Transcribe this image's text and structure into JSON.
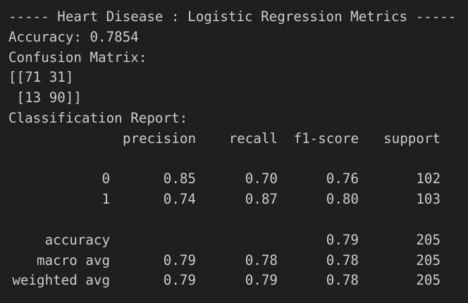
{
  "header": "----- Heart Disease : Logistic Regression Metrics -----",
  "accuracy_line": "Accuracy: 0.7854",
  "confusion_title": "Confusion Matrix:",
  "confusion_rows": [
    "[[71 31]",
    " [13 90]]"
  ],
  "report_title": "Classification Report:",
  "report": {
    "columns": {
      "precision": "precision",
      "recall": "recall",
      "f1": "f1-score",
      "support": "support"
    },
    "rows": [
      {
        "label": "0",
        "precision": "0.85",
        "recall": "0.70",
        "f1": "0.76",
        "support": "102"
      },
      {
        "label": "1",
        "precision": "0.74",
        "recall": "0.87",
        "f1": "0.80",
        "support": "103"
      }
    ],
    "summary": [
      {
        "label": "accuracy",
        "precision": "",
        "recall": "",
        "f1": "0.79",
        "support": "205"
      },
      {
        "label": "macro avg",
        "precision": "0.79",
        "recall": "0.78",
        "f1": "0.78",
        "support": "205"
      },
      {
        "label": "weighted avg",
        "precision": "0.79",
        "recall": "0.79",
        "f1": "0.78",
        "support": "205"
      }
    ]
  }
}
